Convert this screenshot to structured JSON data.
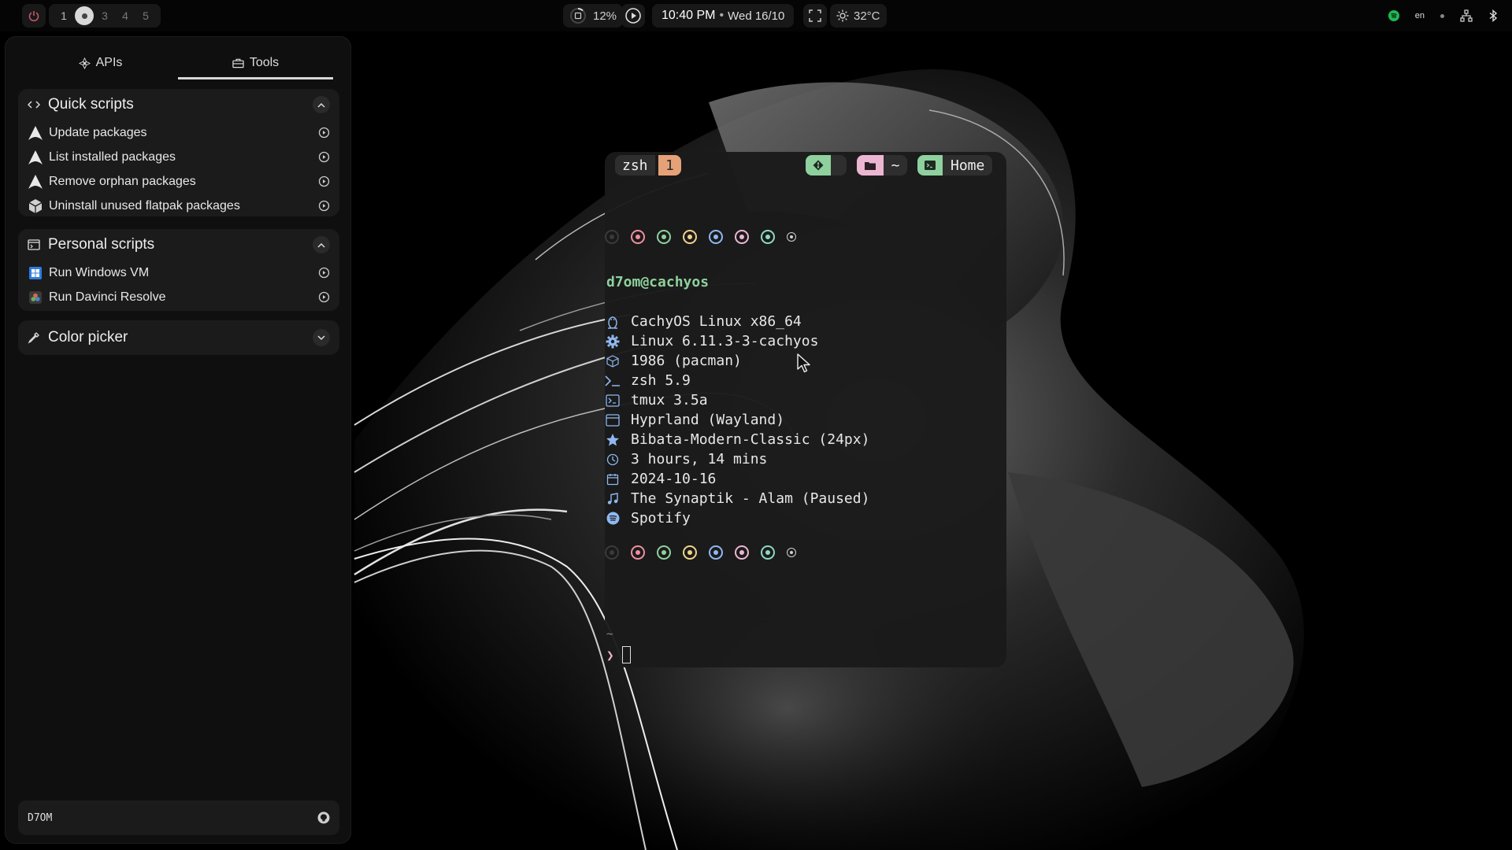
{
  "topbar": {
    "workspaces": [
      "1",
      "3",
      "4",
      "5"
    ],
    "cpu_percent": "12%",
    "clock_time": "10:40 PM",
    "clock_separator": "•",
    "clock_date": "Wed 16/10",
    "temperature": "32°C",
    "language": "en"
  },
  "sidebar": {
    "tabs": [
      {
        "label": "APIs",
        "icon": "apis-icon",
        "active": false
      },
      {
        "label": "Tools",
        "icon": "toolbox-icon",
        "active": true
      }
    ],
    "quick_scripts": {
      "title": "Quick scripts",
      "items": [
        {
          "label": "Update packages",
          "icon": "arch-icon"
        },
        {
          "label": "List installed packages",
          "icon": "arch-icon"
        },
        {
          "label": "Remove orphan packages",
          "icon": "arch-icon"
        },
        {
          "label": "Uninstall unused flatpak packages",
          "icon": "flatpak-icon"
        }
      ]
    },
    "personal_scripts": {
      "title": "Personal scripts",
      "items": [
        {
          "label": "Run Windows VM",
          "icon": "windows-icon"
        },
        {
          "label": "Run Davinci Resolve",
          "icon": "davinci-resolve-icon"
        }
      ]
    },
    "color_picker": {
      "title": "Color picker"
    },
    "footer": {
      "label": "D7OM"
    }
  },
  "terminal": {
    "tab_name": "zsh",
    "tab_number": "1",
    "cwd": "~",
    "home_label": "Home",
    "user_host": "d7om@cachyos",
    "info_lines": [
      {
        "icon": "linux-penguin-icon",
        "text": "CachyOS Linux x86_64"
      },
      {
        "icon": "gear-icon",
        "text": "Linux 6.11.3-3-cachyos"
      },
      {
        "icon": "package-icon",
        "text": "1986 (pacman)"
      },
      {
        "icon": "shell-prompt-icon",
        "text": "zsh 5.9"
      },
      {
        "icon": "terminal-icon",
        "text": "tmux 3.5a"
      },
      {
        "icon": "window-icon",
        "text": "Hyprland (Wayland)"
      },
      {
        "icon": "star-icon",
        "text": "Bibata-Modern-Classic (24px)"
      },
      {
        "icon": "clock-icon",
        "text": "3 hours, 14 mins"
      },
      {
        "icon": "calendar-icon",
        "text": "2024-10-16"
      },
      {
        "icon": "music-note-icon",
        "text": "The Synaptik - Alam (Paused)"
      },
      {
        "icon": "spotify-icon",
        "text": "Spotify"
      }
    ],
    "palette": [
      "#3a3a3a",
      "#f08fa0",
      "#8fd19e",
      "#f2d28c",
      "#8fb8f0",
      "#ecb6d3",
      "#8fd9c4",
      "#d0d0d0"
    ],
    "prompt_tilde": "~",
    "prompt_symbol": "❯"
  },
  "colors": {
    "green": "#8fd19e",
    "pink": "#ecb6d3",
    "orange": "#e6a277",
    "spotify": "#1db954"
  }
}
